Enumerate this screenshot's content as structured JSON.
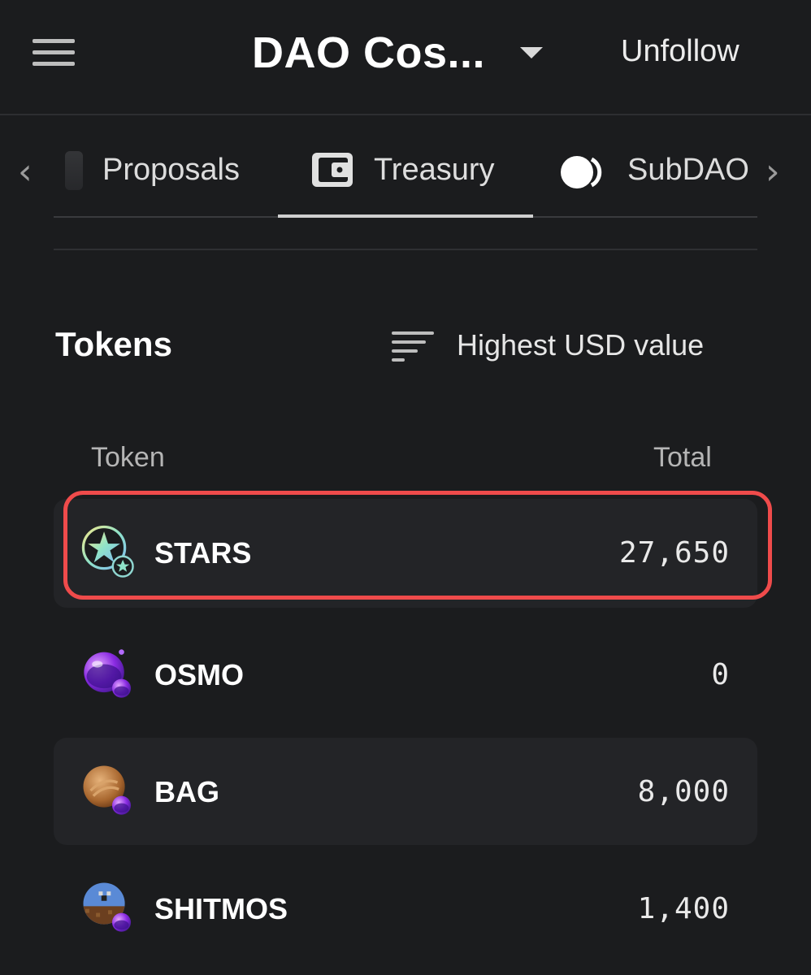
{
  "header": {
    "title": "DAO Cos...",
    "follow_button": "Unfollow"
  },
  "tabs": [
    {
      "label": "Proposals"
    },
    {
      "label": "Treasury",
      "active": true
    },
    {
      "label": "SubDAO"
    }
  ],
  "tokens": {
    "title": "Tokens",
    "sort_label": "Highest USD value",
    "columns": {
      "token": "Token",
      "total": "Total"
    },
    "rows": [
      {
        "symbol": "STARS",
        "total": "27,650",
        "highlighted": true
      },
      {
        "symbol": "OSMO",
        "total": "0"
      },
      {
        "symbol": "BAG",
        "total": "8,000"
      },
      {
        "symbol": "SHITMOS",
        "total": "1,400"
      }
    ]
  },
  "colors": {
    "background": "#1b1c1e",
    "row_shade": "#232427",
    "highlight": "#ef4b4b"
  }
}
